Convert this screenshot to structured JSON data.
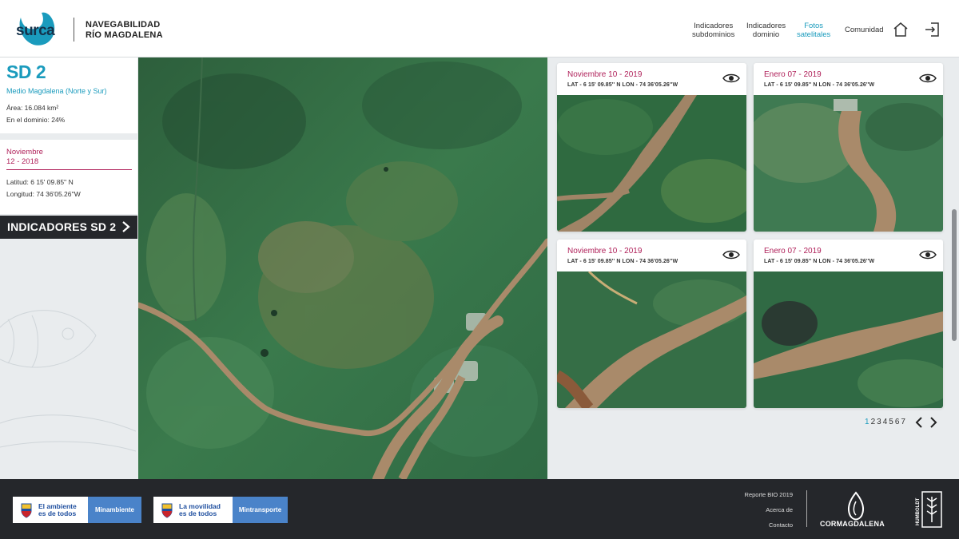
{
  "header": {
    "logo_text": "surca",
    "brand_line1": "NAVEGABILIDAD",
    "brand_line2": "RÍO MAGDALENA",
    "nav": [
      {
        "line1": "Indicadores",
        "line2": "subdominios"
      },
      {
        "line1": "Indicadores",
        "line2": "dominio"
      },
      {
        "line1": "Fotos",
        "line2": "satelitales"
      },
      {
        "line1": "Comunidad",
        "line2": ""
      }
    ],
    "icons": {
      "home": "home-icon",
      "logout": "logout-icon"
    }
  },
  "sidebar": {
    "title": "SD 2",
    "subtitle": "Medio Magdalena (Norte y Sur)",
    "area": "Área: 16.084 km²",
    "domain_pct": "En el dominio: 24%",
    "date_line1": "Noviembre",
    "date_line2": "12 - 2018",
    "lat": "Latitud: 6 15' 09.85'' N",
    "lon": "Longitud: 74 36'05.26''W",
    "indicators_button": "INDICADORES SD 2"
  },
  "thumbnails": [
    {
      "date": "Noviembre 10 - 2019",
      "coords": "LAT - 6 15' 09.85'' N  LON - 74 36'05.26''W"
    },
    {
      "date": "Enero 07 - 2019",
      "coords": "LAT - 6 15' 09.85'' N  LON - 74 36'05.26''W"
    },
    {
      "date": "Noviembre 10 - 2019",
      "coords": "LAT - 6 15' 09.85'' N  LON - 74 36'05.26''W"
    },
    {
      "date": "Enero 07 - 2019",
      "coords": "LAT - 6 15' 09.85'' N  LON - 74 36'05.26''W"
    }
  ],
  "pagination": {
    "pages": [
      "1",
      "2",
      "3",
      "4",
      "5",
      "6",
      "7"
    ],
    "current": "1"
  },
  "footer": {
    "badge1_line1": "El ambiente",
    "badge1_line2": "es de todos",
    "badge1_ministry": "Minambiente",
    "badge2_line1": "La movilidad",
    "badge2_line2": "es de todos",
    "badge2_ministry": "Mintransporte",
    "links": [
      "Reporte BIO 2019",
      "Acerca de",
      "Contacto"
    ],
    "cormagdalena": "CORMAGDALENA",
    "humboldt": "HUMBOLDT"
  },
  "colors": {
    "accent": "#1a9bbd",
    "date": "#b0215a",
    "dark": "#25272b",
    "river": "#a98a6a",
    "forest": "#2e6b45"
  }
}
